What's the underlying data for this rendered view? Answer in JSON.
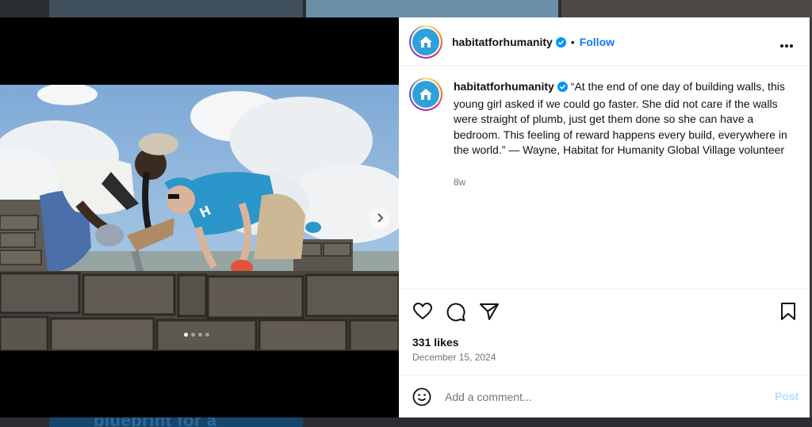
{
  "post": {
    "username": "habitatforhumanity",
    "follow_label": "Follow",
    "separator": "•",
    "caption": "“At the end of one day of building walls, this young girl asked if we could go faster. She did not care if the walls were straight of plumb, just get them done so she can have a bedroom. This feeling of reward happens every build, everywhere in the world.” — Wayne, Habitat for Humanity Global Village volunteer",
    "age": "8w",
    "likes": "331 likes",
    "date": "December 15, 2024",
    "comment_placeholder": "Add a comment...",
    "post_label": "Post",
    "carousel": {
      "total": 4,
      "active": 1
    }
  },
  "background": {
    "card_text": "blueprint for a"
  },
  "icons": {
    "verified": "verified-badge-icon",
    "more": "more-options-icon",
    "like": "heart-icon",
    "comment": "comment-icon",
    "share": "share-icon",
    "save": "bookmark-icon",
    "emoji": "emoji-icon",
    "next": "chevron-right-icon"
  },
  "colors": {
    "accent": "#1877f2",
    "verified": "#0095f6",
    "post_disabled": "#b3dbff",
    "muted": "#737373",
    "brand": "#2fa0d8"
  }
}
